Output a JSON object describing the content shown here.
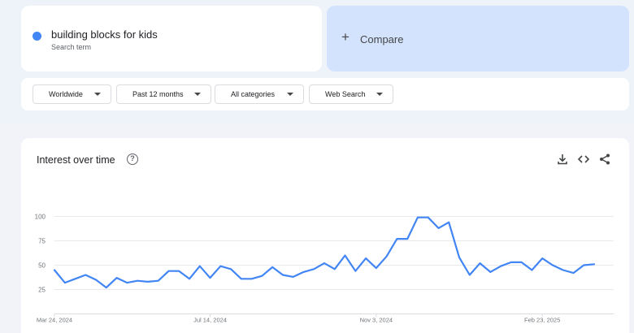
{
  "search": {
    "term": "building blocks for kids",
    "term_type": "Search term",
    "term_color": "#4285f4",
    "compare_label": "Compare"
  },
  "filters": [
    {
      "label": "Worldwide"
    },
    {
      "label": "Past 12 months"
    },
    {
      "label": "All categories"
    },
    {
      "label": "Web Search"
    }
  ],
  "card": {
    "title": "Interest over time",
    "help_icon": "help-circle-icon",
    "actions": [
      "download-icon",
      "embed-code-icon",
      "share-icon"
    ]
  },
  "chart_data": {
    "type": "line",
    "title": "Interest over time",
    "y_ticks": [
      "100",
      "75",
      "50",
      "25"
    ],
    "x_tick_labels": [
      "Mar 24, 2024",
      "Jul 14, 2024",
      "Nov 3, 2024",
      "Feb 23, 2025"
    ],
    "ylim": [
      0,
      100
    ],
    "grid": true,
    "series": [
      {
        "color": "#4285f4",
        "values": [
          45,
          32,
          36,
          40,
          35,
          27,
          37,
          32,
          34,
          33,
          34,
          44,
          44,
          36,
          49,
          37,
          49,
          46,
          36,
          36,
          39,
          48,
          40,
          38,
          43,
          46,
          52,
          46,
          60,
          44,
          57,
          47,
          59,
          77,
          77,
          99,
          99,
          88,
          94,
          58,
          40,
          52,
          43,
          49,
          53,
          53,
          45,
          57,
          50,
          45,
          42,
          50,
          51
        ]
      }
    ]
  }
}
